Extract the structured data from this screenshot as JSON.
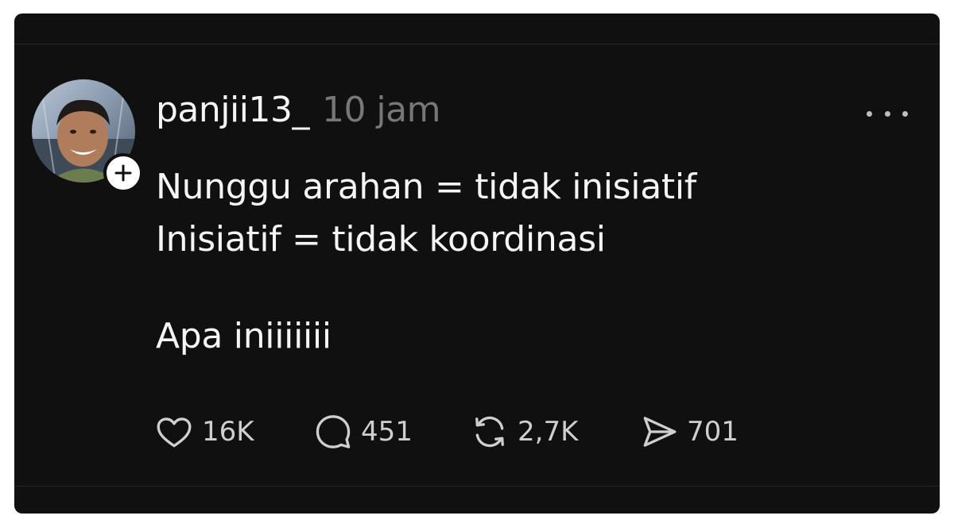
{
  "post": {
    "author": {
      "username": "panjii13_",
      "avatar_icon": "profile-photo",
      "follow_icon": "plus-icon"
    },
    "timestamp": "10 jam",
    "text": {
      "line1": "Nunggu arahan = tidak inisiatif",
      "line2": "Inisiatif = tidak koordinasi",
      "line3": "Apa iniiiiiii"
    },
    "actions": {
      "likes": "16K",
      "replies": "451",
      "reposts": "2,7K",
      "shares": "701"
    }
  },
  "colors": {
    "background": "#101010",
    "text_primary": "#f3f5f7",
    "text_secondary": "#777777",
    "action_text": "#cfcfcf"
  }
}
